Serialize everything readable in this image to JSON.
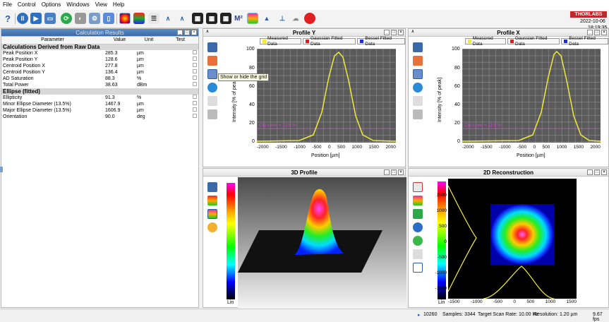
{
  "menu": [
    "File",
    "Control",
    "Options",
    "Windows",
    "View",
    "Help"
  ],
  "brand": "THORLABS",
  "datetime": {
    "date": "2022-10-06",
    "time": "18:19:35"
  },
  "calc": {
    "title": "Calculation Results",
    "headers": [
      "Parameter",
      "Value",
      "Unit",
      "Test"
    ],
    "sections": [
      {
        "title": "Calculations Derived from Raw Data",
        "rows": [
          [
            "Peak Position X",
            "285.3",
            "µm"
          ],
          [
            "Peak Position Y",
            "128.6",
            "µm"
          ],
          [
            "Centroid Position X",
            "277.8",
            "µm"
          ],
          [
            "Centroid Position Y",
            "136.4",
            "µm"
          ],
          [
            "AD Saturation",
            "88.3",
            "%"
          ],
          [
            "Total Power",
            "38.63",
            "dBm"
          ]
        ]
      },
      {
        "title": "Ellipse (fitted)",
        "rows": [
          [
            "Ellipticity",
            "91.3",
            "%"
          ],
          [
            "Minor Ellipse Diameter (13.5%)",
            "1467.9",
            "µm"
          ],
          [
            "Major Ellipse Diameter (13.5%)",
            "1606.9",
            "µm"
          ],
          [
            "Orientation",
            "90.0",
            "deg"
          ]
        ]
      }
    ]
  },
  "profile_y": {
    "title": "Profile Y",
    "legend": [
      "Measured Data",
      "Gaussian Fitted Data",
      "Bessel Fitted Data"
    ],
    "ylabel": "Intensity [% of peak]",
    "xlabel": "Position [µm]",
    "clip": "Clip Level = 13.5 %",
    "x_ticks": [
      "-2000",
      "-1500",
      "-1000",
      "-500",
      "0",
      "500",
      "1000",
      "1500",
      "2000"
    ],
    "y_ticks": [
      "100",
      "80",
      "60",
      "40",
      "20",
      "0"
    ]
  },
  "profile_x": {
    "title": "Profile X",
    "legend": [
      "Measured Data",
      "Gaussian Fitted Data",
      "Bessel Fitted Data"
    ],
    "ylabel": "Intensity [% of peak]",
    "xlabel": "Position [µm]",
    "clip": "Clip Level = 13.5 %",
    "x_ticks": [
      "-2000",
      "-1500",
      "-1000",
      "-500",
      "0",
      "500",
      "1000",
      "1500",
      "2000"
    ],
    "y_ticks": [
      "100",
      "80",
      "60",
      "40",
      "20",
      "0"
    ]
  },
  "profile3d": {
    "title": "3D Profile",
    "scale": "Lin"
  },
  "recon2d": {
    "title": "2D Reconstruction",
    "scale": "Lin",
    "y_ticks": [
      "1500",
      "1000",
      "500",
      "0",
      "-500",
      "-1000",
      "-1500"
    ],
    "x_ticks": [
      "-1500",
      "-1000",
      "-500",
      "0",
      "500",
      "1000",
      "1500"
    ]
  },
  "tooltip": "Show or hide the grid",
  "status": {
    "frames": "10260",
    "samples": "Samples: 3344",
    "rate": "Target Scan Rate: 10.00 Hz",
    "resolution": "Resolution: 1.20 µm",
    "fps": "9.67 fps"
  },
  "colors": {
    "measured": "#f2ea3a",
    "gaussian": "#d92020",
    "bessel": "#1f2fd0",
    "accent": "#3a6aa8"
  }
}
